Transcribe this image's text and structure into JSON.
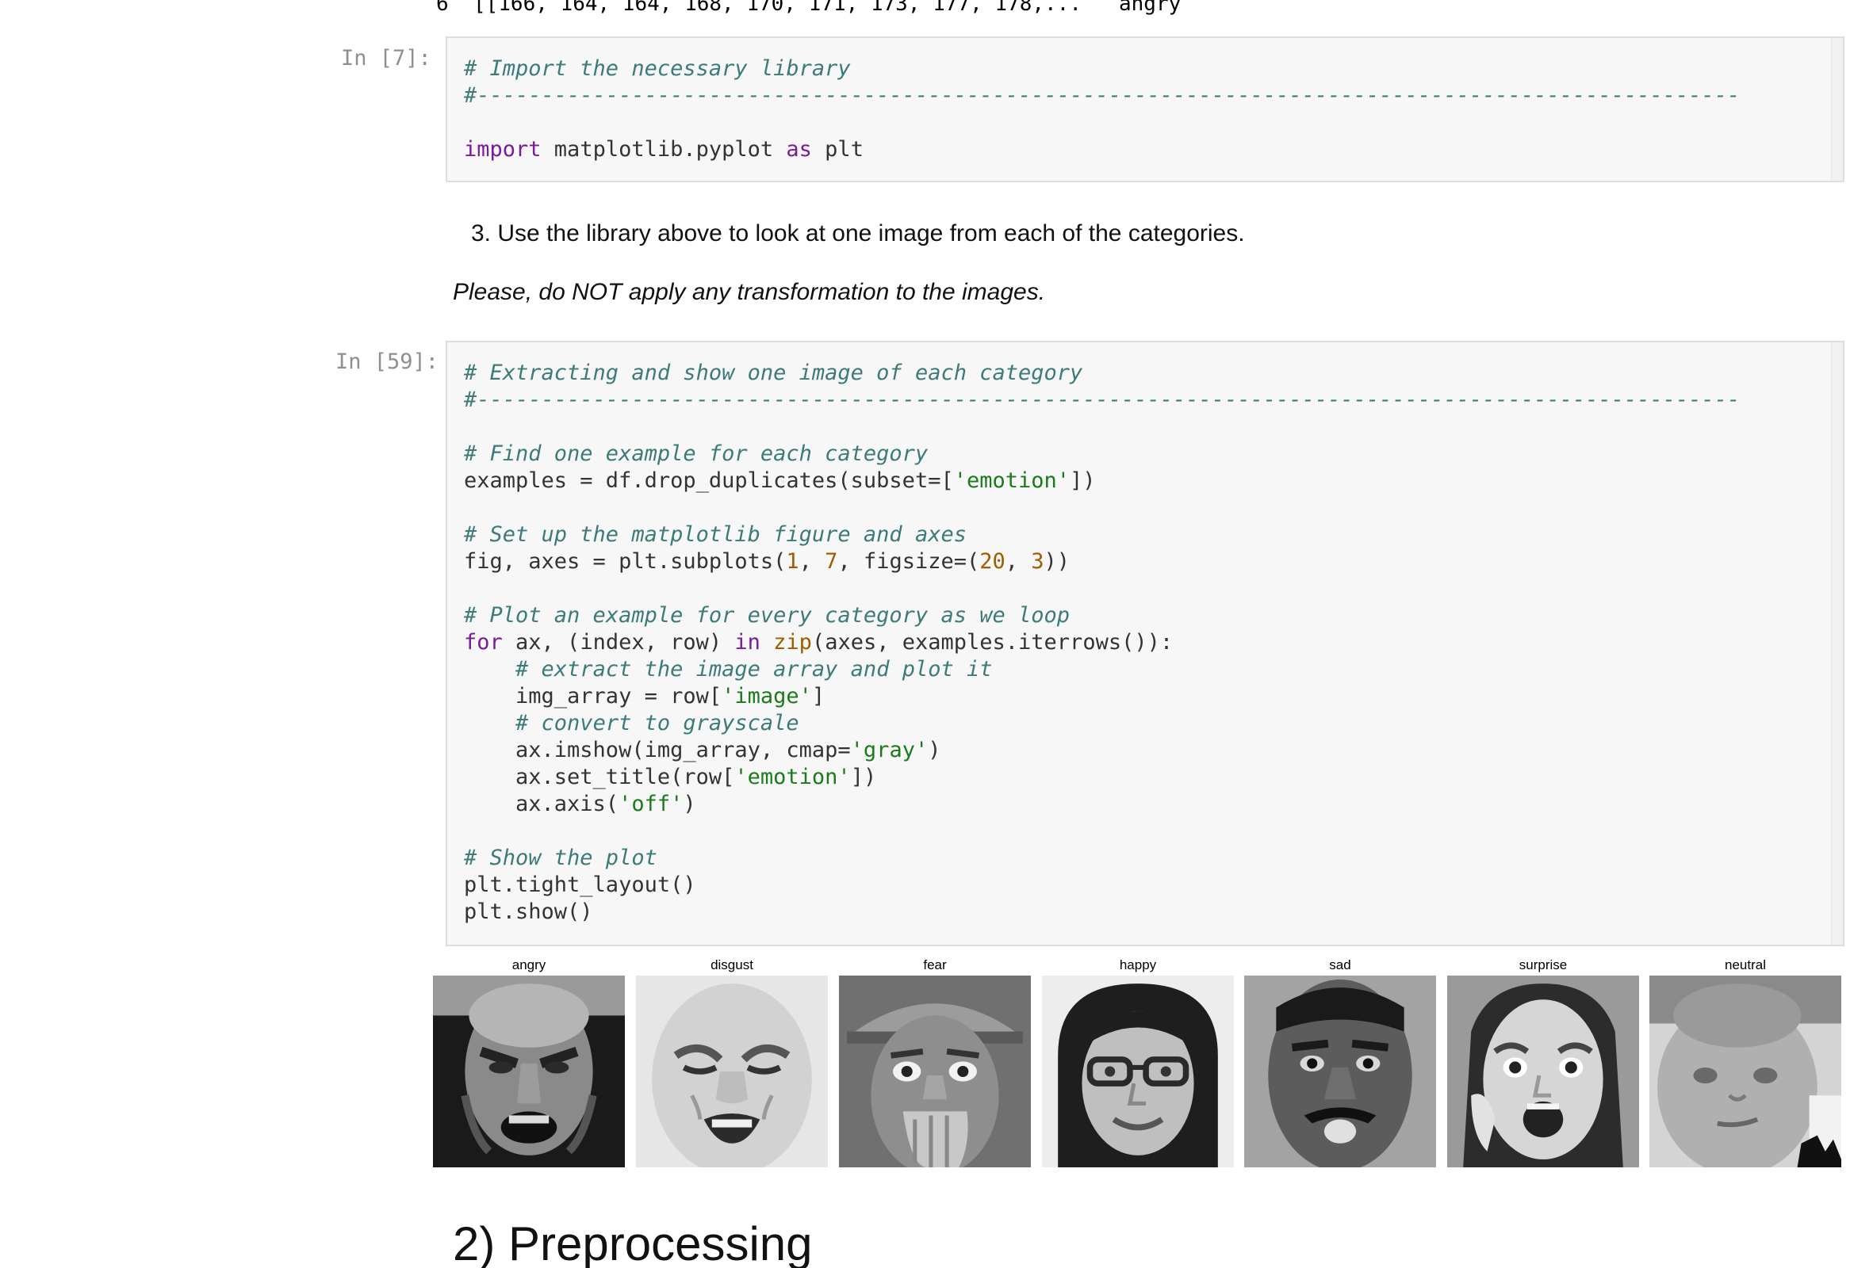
{
  "prev_output": {
    "row_index": "6",
    "pixels": "[[166, 164, 164, 168, 170, 171, 173, 177, 178,...",
    "emotion": "angry"
  },
  "cell7": {
    "prompt": "In [7]:",
    "lines": [
      "# Import the necessary library",
      "#--------------------------------------------------------------------------------------------------",
      "",
      "import matplotlib.pyplot as plt"
    ]
  },
  "markdown": {
    "list_item_number": "3.",
    "list_item_text": "Use the library above to look at one image from each of the categories.",
    "italic_note": "Please, do NOT apply any transformation to the images."
  },
  "cell59": {
    "prompt": "In [59]:",
    "lines": [
      "# Extracting and show one image of each category",
      "#--------------------------------------------------------------------------------------------------",
      "",
      "# Find one example for each category",
      "examples = df.drop_duplicates(subset=['emotion'])",
      "",
      "# Set up the matplotlib figure and axes",
      "fig, axes = plt.subplots(1, 7, figsize=(20, 3))",
      "",
      "# Plot an example for every category as we loop",
      "for ax, (index, row) in zip(axes, examples.iterrows()):",
      "    # extract the image array and plot it",
      "    img_array = row['image']",
      "    # convert to grayscale",
      "    ax.imshow(img_array, cmap='gray')",
      "    ax.set_title(row['emotion'])",
      "    ax.axis('off')",
      "",
      "# Show the plot",
      "plt.tight_layout()",
      "plt.show()"
    ]
  },
  "figure": {
    "panels": [
      {
        "title": "angry",
        "icon": "angry-face-image"
      },
      {
        "title": "disgust",
        "icon": "disgust-face-image"
      },
      {
        "title": "fear",
        "icon": "fear-face-image"
      },
      {
        "title": "happy",
        "icon": "happy-face-image"
      },
      {
        "title": "sad",
        "icon": "sad-face-image"
      },
      {
        "title": "surprise",
        "icon": "surprise-face-image"
      },
      {
        "title": "neutral",
        "icon": "neutral-face-image"
      }
    ]
  },
  "section_heading": "2) Preprocessing",
  "colors": {
    "comment": "#3d7b7b",
    "keyword": "#7a1a9c",
    "string": "#1b7a1b",
    "number": "#a15c00",
    "cell_background": "#f7f7f7",
    "cell_border": "#dedede",
    "prompt": "#8f8f8f"
  }
}
